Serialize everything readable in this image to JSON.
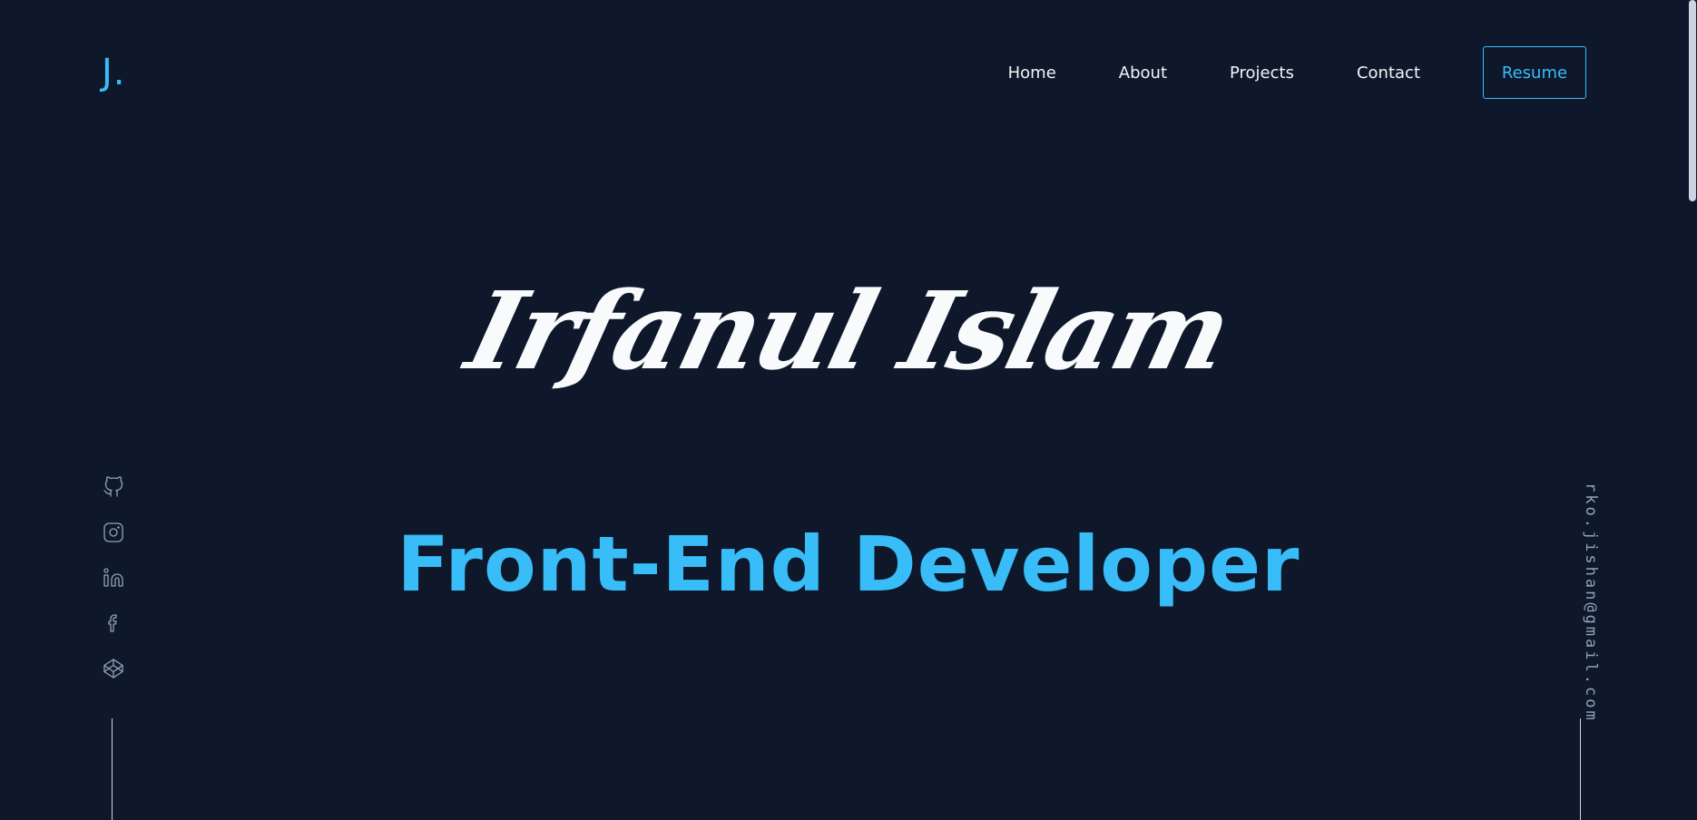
{
  "logo": {
    "text": "J."
  },
  "nav": {
    "links": [
      "Home",
      "About",
      "Projects",
      "Contact"
    ],
    "resume_label": "Resume"
  },
  "hero": {
    "name": "Irfanul Islam",
    "role": "Front-End Developer"
  },
  "social": {
    "icons": [
      "github-icon",
      "instagram-icon",
      "linkedin-icon",
      "facebook-icon",
      "codepen-icon"
    ]
  },
  "email": "rko.jishan@gmail.com",
  "colors": {
    "background": "#0f172a",
    "accent": "#38bdf8",
    "text": "#f1f5f9",
    "muted": "#94a3b8"
  }
}
